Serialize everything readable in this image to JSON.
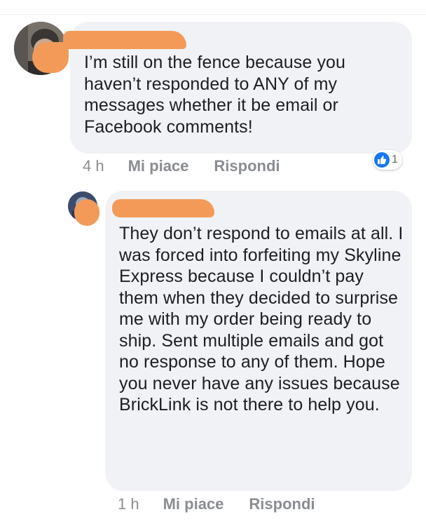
{
  "comments": [
    {
      "text": "I’m still on the fence because you haven’t responded to ANY of my messages whether it be email or Facebook comments!",
      "time": "4 h",
      "like_label": "Mi piace",
      "reply_label": "Rispondi",
      "reaction_count": "1",
      "reaction_icon": "thumbs-up-icon"
    },
    {
      "text": "They don’t respond to emails at all. I was forced into forfeiting my Skyline Express because I couldn’t pay them when they decided to surprise me with my order being ready to ship. Sent multiple emails and got no response to any of them. Hope you never have any issues because BrickLink is not there to help you.",
      "time": "1 h",
      "like_label": "Mi piace",
      "reply_label": "Rispondi"
    }
  ],
  "colors": {
    "bubble": "#f0f2f5",
    "redaction": "#f39a58",
    "meta_text": "#8a8d91",
    "like_blue": "#1877f2"
  }
}
